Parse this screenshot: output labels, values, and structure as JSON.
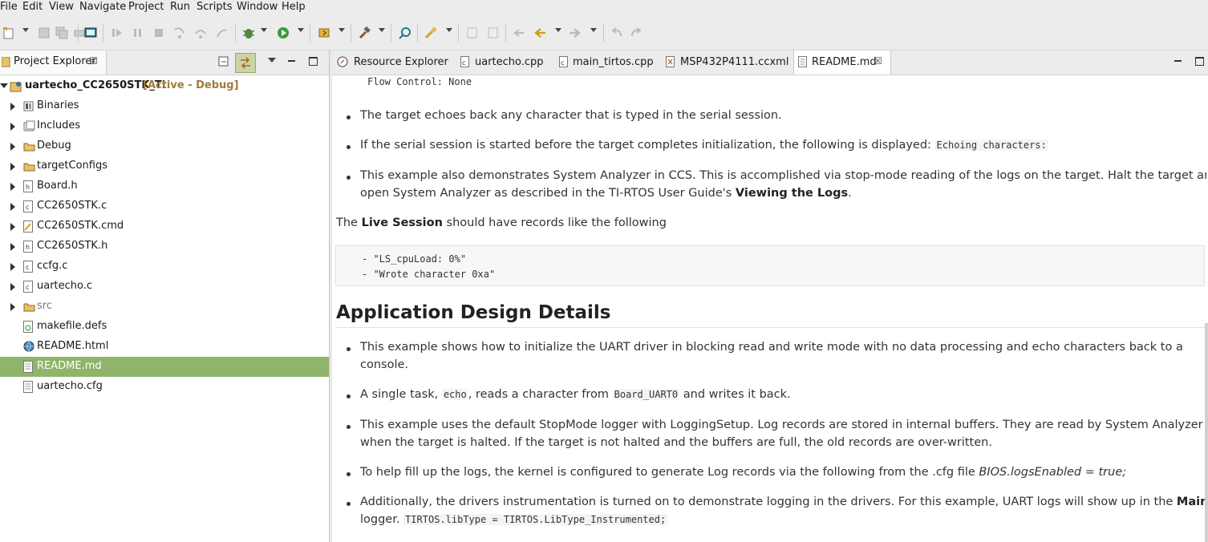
{
  "menu": [
    "File",
    "Edit",
    "View",
    "Navigate",
    "Project",
    "Run",
    "Scripts",
    "Window",
    "Help"
  ],
  "project_explorer": {
    "tab_label": "Project Explorer",
    "project_name": "uartecho_CC2650STK_TI",
    "project_status": "[Active - Debug]",
    "items": [
      {
        "label": "Binaries",
        "icon": "binaries-icon",
        "expandable": true
      },
      {
        "label": "Includes",
        "icon": "includes-icon",
        "expandable": true
      },
      {
        "label": "Debug",
        "icon": "folder-icon",
        "expandable": true
      },
      {
        "label": "targetConfigs",
        "icon": "folder-icon",
        "expandable": true
      },
      {
        "label": "Board.h",
        "icon": "header-file-icon",
        "expandable": true
      },
      {
        "label": "CC2650STK.c",
        "icon": "c-file-icon",
        "expandable": true
      },
      {
        "label": "CC2650STK.cmd",
        "icon": "cmd-file-icon",
        "expandable": true
      },
      {
        "label": "CC2650STK.h",
        "icon": "header-file-icon",
        "expandable": true
      },
      {
        "label": "ccfg.c",
        "icon": "c-file-icon",
        "expandable": true
      },
      {
        "label": "uartecho.c",
        "icon": "c-file-icon",
        "expandable": true
      },
      {
        "label": "src",
        "icon": "folder-icon",
        "expandable": true
      },
      {
        "label": "makefile.defs",
        "icon": "makefile-icon",
        "expandable": false
      },
      {
        "label": "README.html",
        "icon": "html-globe-icon",
        "expandable": false
      },
      {
        "label": "README.md",
        "icon": "text-file-icon",
        "expandable": false,
        "selected": true
      },
      {
        "label": "uartecho.cfg",
        "icon": "text-file-icon",
        "expandable": false
      }
    ]
  },
  "editor_tabs": [
    {
      "label": "Resource Explorer",
      "icon": "compass-icon"
    },
    {
      "label": "uartecho.cpp",
      "icon": "c-file-icon"
    },
    {
      "label": "main_tirtos.cpp",
      "icon": "c-file-icon"
    },
    {
      "label": "MSP432P4111.ccxml",
      "icon": "ccxml-file-icon"
    },
    {
      "label": "README.md",
      "icon": "text-file-icon",
      "active": true
    }
  ],
  "readme": {
    "flow_control": "Flow Control: None",
    "b1": "The target echoes back any character that is typed in the serial session.",
    "b2_text": "If the serial session is started before the target completes initialization, the following is displayed:",
    "b2_code": "Echoing characters:",
    "b3_line1": "This example also demonstrates System Analyzer in CCS. This is accomplished via stop-mode reading of the logs on the target. Halt the target and",
    "b3_line2_a": "open System Analyzer as described in the TI-RTOS User Guide's",
    "b3_line2_bold": "Viewing the Logs",
    "b3_line2_end": ".",
    "live_the": "The",
    "live_bold": "Live Session",
    "live_rest": "should have records like the following",
    "code1": "- \"LS_cpuLoad: 0%\"",
    "code2": "- \"Wrote character 0xa\"",
    "heading": "Application Design Details",
    "d1_line1": "This example shows how to initialize the UART driver in blocking read and write mode with no data processing and echo characters back to a",
    "d1_line2": "console.",
    "d2_a": "A single task,",
    "d2_code1": "echo",
    "d2_b": ", reads a character from",
    "d2_code2": "Board_UART0",
    "d2_c": "and writes it back.",
    "d3_line1": "This example uses the default StopMode logger with LoggingSetup. Log records are stored in internal buffers. They are read by System Analyzer",
    "d3_line2": "when the target is halted. If the target is not halted and the buffers are full, the old records are over-written.",
    "d4_text": "To help fill up the logs, the kernel is configured to generate Log records via the following from the .cfg file",
    "d4_italic": "BIOS.logsEnabled = true;",
    "d5_line1": "Additionally, the drivers instrumentation is turned on to demonstrate logging in the drivers. For this example, UART logs will show up in the",
    "d5_bold": "Main",
    "d5_line2": "logger.",
    "d5_code": "TIRTOS.libType = TIRTOS.LibType_Instrumented;"
  }
}
